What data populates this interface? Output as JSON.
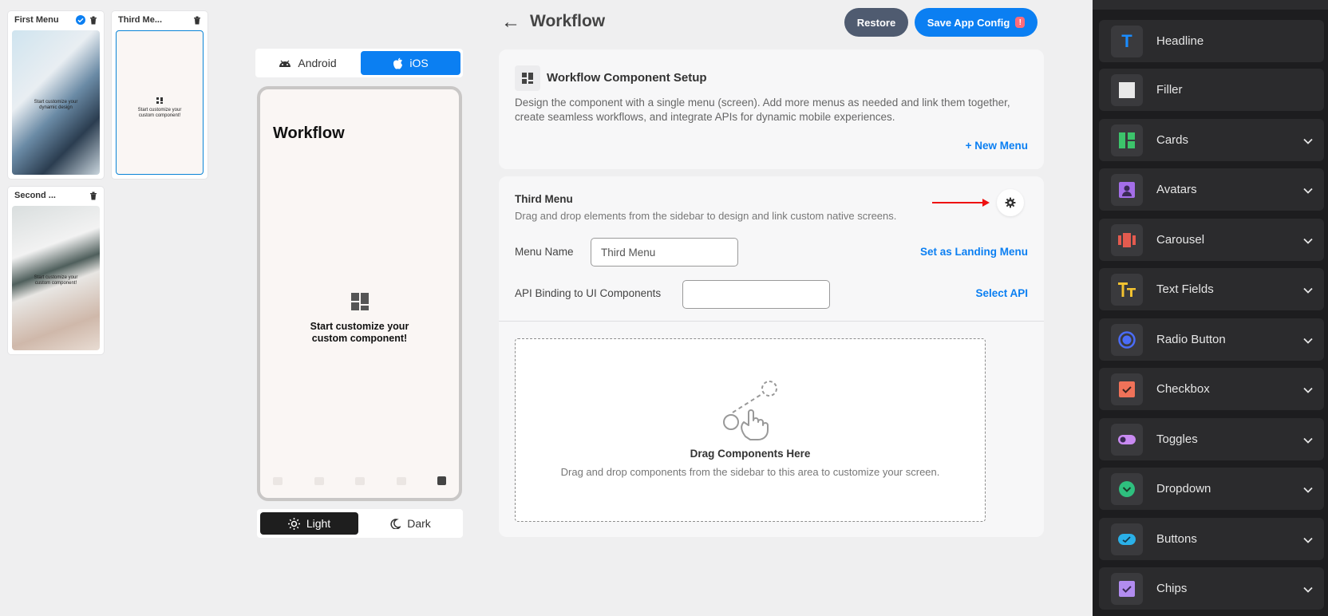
{
  "menus": [
    {
      "label": "First Menu",
      "caption": "Start customize your dynamic design"
    },
    {
      "label": "Third Me...",
      "caption": "Start customize your custom component!"
    },
    {
      "label": "Second ...",
      "caption": "Start customize your custom component!"
    }
  ],
  "platform": {
    "android": "Android",
    "ios": "iOS",
    "selected": "iOS"
  },
  "phone": {
    "title": "Workflow",
    "placeholder_line1": "Start customize your",
    "placeholder_line2": "custom component!"
  },
  "theme": {
    "light": "Light",
    "dark": "Dark",
    "selected": "Light"
  },
  "header": {
    "back_icon": "arrow-left-icon",
    "title": "Workflow",
    "restore": "Restore",
    "save": "Save App Config",
    "save_badge": "!"
  },
  "setup": {
    "title": "Workflow Component Setup",
    "description": "Design the component with a single menu (screen). Add more menus as needed and link them together, create seamless workflows, and integrate APIs for dynamic mobile experiences.",
    "new_menu": "+ New Menu"
  },
  "menu_card": {
    "title": "Third Menu",
    "subtitle": "Drag and drop elements from the sidebar to design and link custom native screens.",
    "menu_name_label": "Menu Name",
    "menu_name_value": "Third Menu",
    "landing_link": "Set as Landing Menu",
    "api_label": "API Binding to UI Components",
    "api_value": "",
    "select_api": "Select API",
    "dropzone_title": "Drag Components Here",
    "dropzone_desc": "Drag and drop components from the sidebar to this area to customize your screen."
  },
  "sidebar": {
    "items": [
      {
        "label": "Headline",
        "icon": "headline-icon",
        "color": "#1a8cff",
        "expandable": false
      },
      {
        "label": "Filler",
        "icon": "filler-icon",
        "color": "#e8e8e8",
        "expandable": false
      },
      {
        "label": "Cards",
        "icon": "cards-icon",
        "color": "#3cc46b",
        "expandable": true
      },
      {
        "label": "Avatars",
        "icon": "avatars-icon",
        "color": "#a46ee8",
        "expandable": true
      },
      {
        "label": "Carousel",
        "icon": "carousel-icon",
        "color": "#e45b4f",
        "expandable": true
      },
      {
        "label": "Text Fields",
        "icon": "text-fields-icon",
        "color": "#f2c230",
        "expandable": true
      },
      {
        "label": "Radio Button",
        "icon": "radio-button-icon",
        "color": "#4a6cf7",
        "expandable": true
      },
      {
        "label": "Checkbox",
        "icon": "checkbox-icon",
        "color": "#f07259",
        "expandable": true
      },
      {
        "label": "Toggles",
        "icon": "toggles-icon",
        "color": "#c98af2",
        "expandable": true
      },
      {
        "label": "Dropdown",
        "icon": "dropdown-icon",
        "color": "#2ebf7e",
        "expandable": true
      },
      {
        "label": "Buttons",
        "icon": "buttons-icon",
        "color": "#2ab0e8",
        "expandable": true
      },
      {
        "label": "Chips",
        "icon": "chips-icon",
        "color": "#b28cf0",
        "expandable": true
      }
    ]
  },
  "colors": {
    "accent": "#0b7ff2",
    "restore": "#4f5b70",
    "sidebar_bg": "#1d1d1f"
  }
}
